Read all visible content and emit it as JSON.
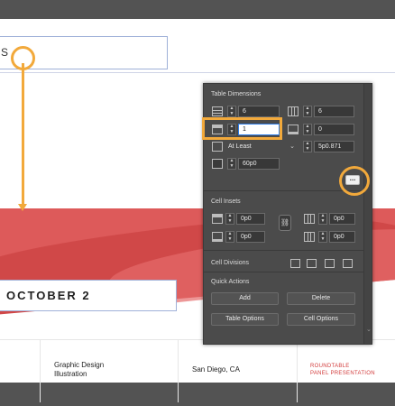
{
  "document": {
    "title_fragment": "S",
    "date_heading": "OCTOBER 2",
    "row": {
      "topic": "Graphic Design\nIllustration",
      "location": "San Diego, CA",
      "event_type": "ROUNDTABLE\nPANEL PRESENTATION"
    },
    "colors": {
      "band": "#dd5a5a",
      "accent_red": "#d23a3a",
      "frame_blue": "#9fb0d8"
    }
  },
  "callouts": {
    "color": "#f2a93b"
  },
  "panel": {
    "table_dimensions": {
      "heading": "Table Dimensions",
      "body_rows": "6",
      "columns": "6",
      "header_rows": "1",
      "footer_rows": "0",
      "row_height_mode": "At Least",
      "row_height_value": "5p0.871",
      "max_height": "60p0"
    },
    "more_icon": "ellipsis-icon",
    "cell_insets": {
      "heading": "Cell Insets",
      "top": "0p0",
      "bottom": "0p0",
      "left": "0p0",
      "right": "0p0"
    },
    "cell_divisions": {
      "heading": "Cell Divisions"
    },
    "quick_actions": {
      "heading": "Quick Actions",
      "add": "Add",
      "delete": "Delete",
      "table_options": "Table Options",
      "cell_options": "Cell Options"
    }
  }
}
